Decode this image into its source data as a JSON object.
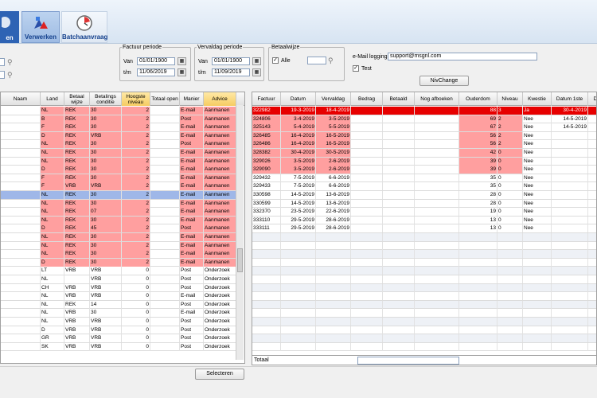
{
  "toolbar": {
    "partial_label": "en",
    "verwerken_label": "Verwerken",
    "batch_label": "Batchaanvraag"
  },
  "filters": {
    "factuur_periode": {
      "legend": "Factuur periode",
      "van_label": "Van",
      "van_value": "01/01/1900",
      "tm_label": "t/m",
      "tm_value": "11/06/2019"
    },
    "vervaldag_periode": {
      "legend": "Vervaldag periode",
      "van_label": "Van",
      "van_value": "01/01/1900",
      "tm_label": "t/m",
      "tm_value": "11/09/2019"
    },
    "betaalwijze": {
      "legend": "Betaalwijze",
      "alle_label": "Alle",
      "alle_checked": "✓"
    },
    "email": {
      "label": "e-Mail logging",
      "value": "support@msgnl.com",
      "test_label": "Test",
      "test_checked": "✓"
    },
    "nivchange_label": "NivChange"
  },
  "left_grid": {
    "headers": [
      "Naam",
      "Land",
      "Betaal wijze",
      "Betalings conditie",
      "Hoogste niveau",
      "Totaal open",
      "Manier",
      "Advice"
    ],
    "rows": [
      {
        "land": "NL",
        "betaal": "REK",
        "cond": "30",
        "niveau": "2",
        "manier": "E-mail",
        "advice": "Aanmanen",
        "style": "pink"
      },
      {
        "land": "B",
        "betaal": "REK",
        "cond": "30",
        "niveau": "2",
        "manier": "Post",
        "advice": "Aanmanen",
        "style": "pink"
      },
      {
        "land": "F",
        "betaal": "REK",
        "cond": "30",
        "niveau": "2",
        "manier": "E-mail",
        "advice": "Aanmanen",
        "style": "pink"
      },
      {
        "land": "D",
        "betaal": "REK",
        "cond": "VRB",
        "niveau": "2",
        "manier": "E-mail",
        "advice": "Aanmanen",
        "style": "pink"
      },
      {
        "land": "NL",
        "betaal": "REK",
        "cond": "30",
        "niveau": "2",
        "manier": "Post",
        "advice": "Aanmanen",
        "style": "pink"
      },
      {
        "land": "NL",
        "betaal": "REK",
        "cond": "30",
        "niveau": "2",
        "manier": "E-mail",
        "advice": "Aanmanen",
        "style": "pink"
      },
      {
        "land": "NL",
        "betaal": "REK",
        "cond": "30",
        "niveau": "2",
        "manier": "E-mail",
        "advice": "Aanmanen",
        "style": "pink"
      },
      {
        "land": "D",
        "betaal": "REK",
        "cond": "30",
        "niveau": "2",
        "manier": "E-mail",
        "advice": "Aanmanen",
        "style": "pink"
      },
      {
        "land": "F",
        "betaal": "REK",
        "cond": "30",
        "niveau": "2",
        "manier": "E-mail",
        "advice": "Aanmanen",
        "style": "pink"
      },
      {
        "land": "F",
        "betaal": "VRB",
        "cond": "VRB",
        "niveau": "2",
        "manier": "E-mail",
        "advice": "Aanmanen",
        "style": "pink"
      },
      {
        "land": "NL",
        "betaal": "REK",
        "cond": "30",
        "niveau": "2",
        "manier": "E-mail",
        "advice": "Aanmanen",
        "style": "sel"
      },
      {
        "land": "NL",
        "betaal": "REK",
        "cond": "30",
        "niveau": "2",
        "manier": "E-mail",
        "advice": "Aanmanen",
        "style": "pink"
      },
      {
        "land": "NL",
        "betaal": "REK",
        "cond": "07",
        "niveau": "2",
        "manier": "E-mail",
        "advice": "Aanmanen",
        "style": "pink"
      },
      {
        "land": "NL",
        "betaal": "REK",
        "cond": "30",
        "niveau": "2",
        "manier": "E-mail",
        "advice": "Aanmanen",
        "style": "pink"
      },
      {
        "land": "D",
        "betaal": "REK",
        "cond": "45",
        "niveau": "2",
        "manier": "Post",
        "advice": "Aanmanen",
        "style": "pink"
      },
      {
        "land": "NL",
        "betaal": "REK",
        "cond": "30",
        "niveau": "2",
        "manier": "E-mail",
        "advice": "Aanmanen",
        "style": "pink"
      },
      {
        "land": "NL",
        "betaal": "REK",
        "cond": "30",
        "niveau": "2",
        "manier": "E-mail",
        "advice": "Aanmanen",
        "style": "pink"
      },
      {
        "land": "NL",
        "betaal": "REK",
        "cond": "30",
        "niveau": "2",
        "manier": "E-mail",
        "advice": "Aanmanen",
        "style": "pink"
      },
      {
        "land": "D",
        "betaal": "REK",
        "cond": "30",
        "niveau": "2",
        "manier": "E-mail",
        "advice": "Aanmanen",
        "style": "pink"
      },
      {
        "land": "LT",
        "betaal": "VRB",
        "cond": "VRB",
        "niveau": "0",
        "manier": "Post",
        "advice": "Onderzoek",
        "style": "white"
      },
      {
        "land": "NL",
        "betaal": "",
        "cond": "VRB",
        "niveau": "0",
        "manier": "Post",
        "advice": "Onderzoek",
        "style": "white"
      },
      {
        "land": "CH",
        "betaal": "VRB",
        "cond": "VRB",
        "niveau": "0",
        "manier": "Post",
        "advice": "Onderzoek",
        "style": "white"
      },
      {
        "land": "NL",
        "betaal": "VRB",
        "cond": "VRB",
        "niveau": "0",
        "manier": "E-mail",
        "advice": "Onderzoek",
        "style": "white"
      },
      {
        "land": "NL",
        "betaal": "REK",
        "cond": "14",
        "niveau": "0",
        "manier": "Post",
        "advice": "Onderzoek",
        "style": "white"
      },
      {
        "land": "NL",
        "betaal": "VRB",
        "cond": "30",
        "niveau": "0",
        "manier": "E-mail",
        "advice": "Onderzoek",
        "style": "white"
      },
      {
        "land": "NL",
        "betaal": "VRB",
        "cond": "VRB",
        "niveau": "0",
        "manier": "Post",
        "advice": "Onderzoek",
        "style": "white"
      },
      {
        "land": "D",
        "betaal": "VRB",
        "cond": "VRB",
        "niveau": "0",
        "manier": "Post",
        "advice": "Onderzoek",
        "style": "white"
      },
      {
        "land": "GR",
        "betaal": "VRB",
        "cond": "VRB",
        "niveau": "0",
        "manier": "Post",
        "advice": "Onderzoek",
        "style": "white"
      },
      {
        "land": "SK",
        "betaal": "VRB",
        "cond": "VRB",
        "niveau": "0",
        "manier": "Post",
        "advice": "Onderzoek",
        "style": "white"
      }
    ]
  },
  "right_grid": {
    "headers": [
      "Factuur",
      "Datum",
      "Vervaldag",
      "Bedrag",
      "Betaald",
      "Nog afboeken",
      "Ouderdom",
      "Niveau",
      "Kwestie",
      "Datum 1ste",
      "Dat"
    ],
    "rows": [
      {
        "factuur": "322982",
        "datum": "19-3-2019",
        "verval": "18-4-2019",
        "ouderdom": "88",
        "niveau": "3",
        "kwestie": "Ja",
        "d1": "30-4-2019",
        "d2": "",
        "style": "red"
      },
      {
        "factuur": "324806",
        "datum": "3-4-2019",
        "verval": "3-5-2019",
        "ouderdom": "69",
        "niveau": "2",
        "kwestie": "Nee",
        "d1": "14-5-2019",
        "d2": "",
        "style": "pink"
      },
      {
        "factuur": "325143",
        "datum": "5-4-2019",
        "verval": "5-5-2019",
        "ouderdom": "67",
        "niveau": "2",
        "kwestie": "Nee",
        "d1": "14-5-2019",
        "d2": "",
        "style": "pink"
      },
      {
        "factuur": "326485",
        "datum": "16-4-2019",
        "verval": "16-5-2019",
        "ouderdom": "56",
        "niveau": "2",
        "kwestie": "Nee",
        "d1": "",
        "d2": "",
        "style": "pink"
      },
      {
        "factuur": "326486",
        "datum": "16-4-2019",
        "verval": "16-5-2019",
        "ouderdom": "56",
        "niveau": "2",
        "kwestie": "Nee",
        "d1": "",
        "d2": "",
        "style": "pink"
      },
      {
        "factuur": "328382",
        "datum": "30-4-2019",
        "verval": "30-5-2019",
        "ouderdom": "42",
        "niveau": "0",
        "kwestie": "Nee",
        "d1": "",
        "d2": "",
        "style": "pink"
      },
      {
        "factuur": "329026",
        "datum": "3-5-2019",
        "verval": "2-6-2019",
        "ouderdom": "39",
        "niveau": "0",
        "kwestie": "Nee",
        "d1": "",
        "d2": "",
        "style": "pink"
      },
      {
        "factuur": "329090",
        "datum": "3-5-2019",
        "verval": "2-6-2019",
        "ouderdom": "39",
        "niveau": "0",
        "kwestie": "Nee",
        "d1": "",
        "d2": "",
        "style": "pink"
      },
      {
        "factuur": "329432",
        "datum": "7-5-2019",
        "verval": "6-6-2019",
        "ouderdom": "35",
        "niveau": "0",
        "kwestie": "Nee",
        "d1": "",
        "d2": "",
        "style": "white"
      },
      {
        "factuur": "329433",
        "datum": "7-5-2019",
        "verval": "6-6-2019",
        "ouderdom": "35",
        "niveau": "0",
        "kwestie": "Nee",
        "d1": "",
        "d2": "",
        "style": "white"
      },
      {
        "factuur": "330598",
        "datum": "14-5-2019",
        "verval": "13-6-2019",
        "ouderdom": "28",
        "niveau": "0",
        "kwestie": "Nee",
        "d1": "",
        "d2": "",
        "style": "white"
      },
      {
        "factuur": "330599",
        "datum": "14-5-2019",
        "verval": "13-6-2019",
        "ouderdom": "28",
        "niveau": "0",
        "kwestie": "Nee",
        "d1": "",
        "d2": "",
        "style": "white"
      },
      {
        "factuur": "332370",
        "datum": "23-5-2019",
        "verval": "22-6-2019",
        "ouderdom": "19",
        "niveau": "0",
        "kwestie": "Nee",
        "d1": "",
        "d2": "",
        "style": "white"
      },
      {
        "factuur": "333110",
        "datum": "29-5-2019",
        "verval": "28-6-2019",
        "ouderdom": "13",
        "niveau": "0",
        "kwestie": "Nee",
        "d1": "",
        "d2": "",
        "style": "white"
      },
      {
        "factuur": "333111",
        "datum": "29-5-2019",
        "verval": "28-6-2019",
        "ouderdom": "13",
        "niveau": "0",
        "kwestie": "Nee",
        "d1": "",
        "d2": "",
        "style": "white"
      }
    ],
    "totaal_label": "Totaal"
  },
  "selecteren_label": "Selecteren",
  "colors": {
    "pink": "#ff9f9f",
    "red": "#e70000",
    "selected": "#9fb7e8",
    "toolbar_text": "#123f8c"
  }
}
